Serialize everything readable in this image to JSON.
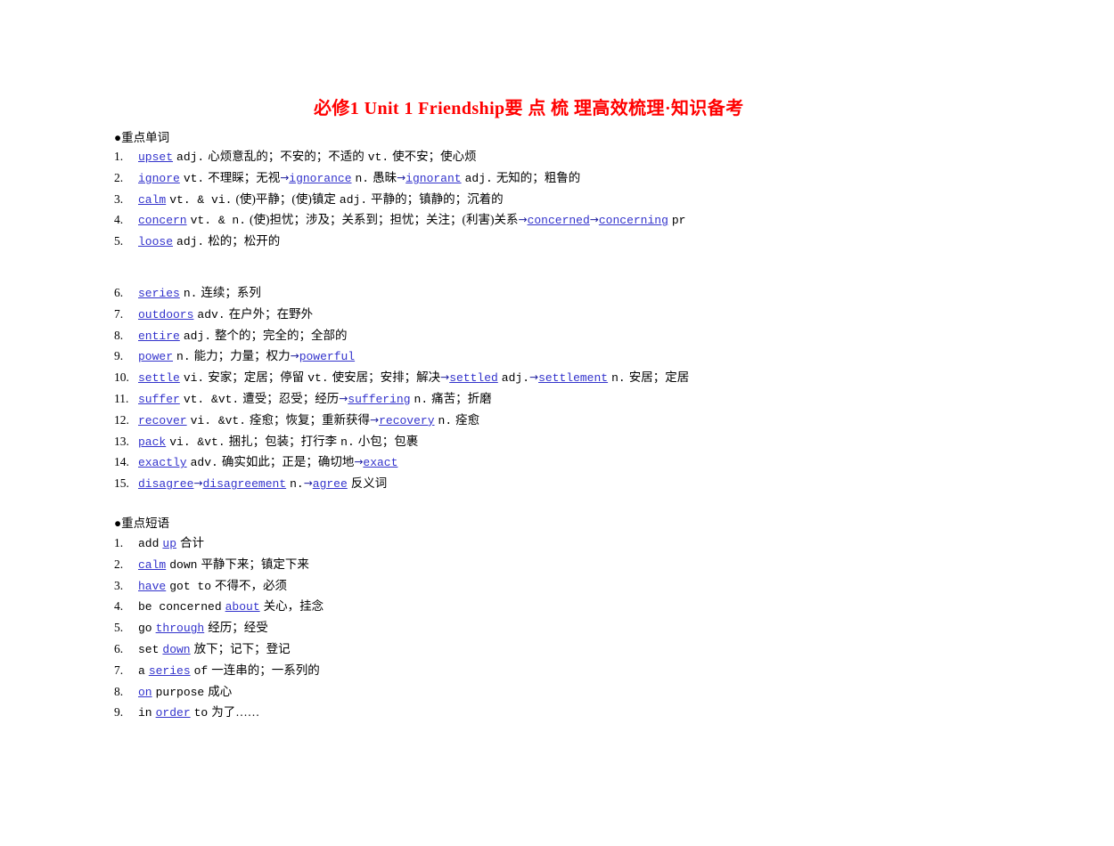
{
  "document": {
    "title": "必修1  Unit 1  Friendship要 点 梳 理高效梳理·知识备考",
    "title_color": "#ff0000",
    "keyword_color": "#3333cc",
    "background": "#ffffff"
  },
  "sections": [
    {
      "heading": "●重点单词",
      "heading_bullet": "●",
      "heading_text": "重点单词",
      "entries": [
        {
          "num": "1.",
          "parts": [
            {
              "t": "kw",
              "v": "upset"
            },
            {
              "t": "w",
              "v": "adj."
            },
            {
              "t": "cn",
              "v": "心烦意乱的；不安的；不适的"
            },
            {
              "t": "w",
              "v": "vt."
            },
            {
              "t": "cn",
              "v": "使不安；使心烦"
            }
          ]
        },
        {
          "num": "2.",
          "parts": [
            {
              "t": "kw",
              "v": "ignore"
            },
            {
              "t": "w",
              "v": "vt."
            },
            {
              "t": "cn",
              "v": "不理睬；无视"
            },
            {
              "t": "arrow",
              "v": "→"
            },
            {
              "t": "kw",
              "v": "ignorance"
            },
            {
              "t": "w",
              "v": "n."
            },
            {
              "t": "cn",
              "v": "愚昧"
            },
            {
              "t": "arrow",
              "v": "→"
            },
            {
              "t": "kw",
              "v": "ignorant"
            },
            {
              "t": "w",
              "v": "adj."
            },
            {
              "t": "cn",
              "v": "无知的；粗鲁的"
            }
          ]
        },
        {
          "num": "3.",
          "parts": [
            {
              "t": "kw",
              "v": "calm"
            },
            {
              "t": "w",
              "v": "vt. & vi."
            },
            {
              "t": "cn",
              "v": "(使)平静；(使)镇定"
            },
            {
              "t": "w",
              "v": "adj."
            },
            {
              "t": "cn",
              "v": "平静的；镇静的；沉着的"
            }
          ]
        },
        {
          "num": "4.",
          "parts": [
            {
              "t": "kw",
              "v": "concern"
            },
            {
              "t": "w",
              "v": "vt. & n."
            },
            {
              "t": "cn",
              "v": "(使)担忧；涉及；关系到；担忧；关注；(利害)关系"
            },
            {
              "t": "arrow",
              "v": "→"
            },
            {
              "t": "kw",
              "v": "concerned"
            },
            {
              "t": "arrow",
              "v": "→"
            },
            {
              "t": "kw",
              "v": "concerning"
            },
            {
              "t": "w",
              "v": "pr"
            }
          ]
        },
        {
          "num": "5.",
          "parts": [
            {
              "t": "kw",
              "v": "loose"
            },
            {
              "t": "w",
              "v": "adj."
            },
            {
              "t": "cn",
              "v": "松的；松开的"
            }
          ]
        }
      ],
      "entries_group2": [
        {
          "num": "6.",
          "parts": [
            {
              "t": "kw",
              "v": "series"
            },
            {
              "t": "w",
              "v": "n."
            },
            {
              "t": "cn",
              "v": "连续；系列"
            }
          ]
        },
        {
          "num": "7.",
          "parts": [
            {
              "t": "kw",
              "v": "outdoors"
            },
            {
              "t": "w",
              "v": "adv."
            },
            {
              "t": "cn",
              "v": "在户外；在野外"
            }
          ]
        },
        {
          "num": "8.",
          "parts": [
            {
              "t": "kw",
              "v": "entire"
            },
            {
              "t": "w",
              "v": "adj."
            },
            {
              "t": "cn",
              "v": "整个的；完全的；全部的"
            }
          ]
        },
        {
          "num": "9.",
          "parts": [
            {
              "t": "kw",
              "v": "power"
            },
            {
              "t": "w",
              "v": "n."
            },
            {
              "t": "cn",
              "v": "能力；力量；权力"
            },
            {
              "t": "arrow",
              "v": "→"
            },
            {
              "t": "kw",
              "v": "powerful"
            }
          ]
        },
        {
          "num": "10.",
          "parts": [
            {
              "t": "kw",
              "v": "settle"
            },
            {
              "t": "w",
              "v": "vi."
            },
            {
              "t": "cn",
              "v": "安家；定居；停留"
            },
            {
              "t": "w",
              "v": "vt."
            },
            {
              "t": "cn",
              "v": "使安居；安排；解决"
            },
            {
              "t": "arrow",
              "v": "→"
            },
            {
              "t": "kw",
              "v": "settled"
            },
            {
              "t": "w",
              "v": "adj."
            },
            {
              "t": "arrow",
              "v": "→"
            },
            {
              "t": "kw",
              "v": "settlement"
            },
            {
              "t": "w",
              "v": "n."
            },
            {
              "t": "cn",
              "v": "安居；定居"
            }
          ]
        },
        {
          "num": "11.",
          "parts": [
            {
              "t": "kw",
              "v": "suffer"
            },
            {
              "t": "w",
              "v": "vt. &vt."
            },
            {
              "t": "cn",
              "v": "遭受；忍受；经历"
            },
            {
              "t": "arrow",
              "v": "→"
            },
            {
              "t": "kw",
              "v": "suffering"
            },
            {
              "t": "w",
              "v": "n."
            },
            {
              "t": "cn",
              "v": "痛苦；折磨"
            }
          ]
        },
        {
          "num": "12.",
          "parts": [
            {
              "t": "kw",
              "v": "recover"
            },
            {
              "t": "w",
              "v": "vi. &vt."
            },
            {
              "t": "cn",
              "v": "痊愈；恢复；重新获得"
            },
            {
              "t": "arrow",
              "v": "→"
            },
            {
              "t": "kw",
              "v": "recovery"
            },
            {
              "t": "w",
              "v": "n."
            },
            {
              "t": "cn",
              "v": "痊愈"
            }
          ]
        },
        {
          "num": "13.",
          "parts": [
            {
              "t": "kw",
              "v": "pack"
            },
            {
              "t": "w",
              "v": "vi. &vt."
            },
            {
              "t": "cn",
              "v": "捆扎；包装；打行李"
            },
            {
              "t": "w",
              "v": "n."
            },
            {
              "t": "cn",
              "v": "小包；包裹"
            }
          ]
        },
        {
          "num": "14.",
          "parts": [
            {
              "t": "kw",
              "v": "exactly"
            },
            {
              "t": "w",
              "v": "adv."
            },
            {
              "t": "cn",
              "v": "确实如此；正是；确切地"
            },
            {
              "t": "arrow",
              "v": "→"
            },
            {
              "t": "kw",
              "v": "exact"
            }
          ]
        },
        {
          "num": "15.",
          "parts": [
            {
              "t": "kw",
              "v": "disagree"
            },
            {
              "t": "arrow",
              "v": "→"
            },
            {
              "t": "kw",
              "v": "disagreement"
            },
            {
              "t": "w",
              "v": "n."
            },
            {
              "t": "arrow",
              "v": "→"
            },
            {
              "t": "kw",
              "v": "agree"
            },
            {
              "t": "cn",
              "v": "反义词"
            }
          ]
        }
      ]
    },
    {
      "heading": "●重点短语",
      "heading_bullet": "●",
      "heading_text": "重点短语",
      "entries": [
        {
          "num": "1.",
          "parts": [
            {
              "t": "w",
              "v": "add"
            },
            {
              "t": "kw",
              "v": "up"
            },
            {
              "t": "cn",
              "v": "合计"
            }
          ]
        },
        {
          "num": "2.",
          "parts": [
            {
              "t": "kw",
              "v": "calm"
            },
            {
              "t": "w",
              "v": "down"
            },
            {
              "t": "cn",
              "v": "平静下来；镇定下来"
            }
          ]
        },
        {
          "num": "3.",
          "parts": [
            {
              "t": "kw",
              "v": "have"
            },
            {
              "t": "w",
              "v": "got to"
            },
            {
              "t": "cn",
              "v": "不得不，必须"
            }
          ]
        },
        {
          "num": "4.",
          "parts": [
            {
              "t": "w",
              "v": "be concerned"
            },
            {
              "t": "kw",
              "v": "about"
            },
            {
              "t": "cn",
              "v": "关心，挂念"
            }
          ]
        },
        {
          "num": "5.",
          "parts": [
            {
              "t": "w",
              "v": "go"
            },
            {
              "t": "kw",
              "v": "through"
            },
            {
              "t": "cn",
              "v": "经历；经受"
            }
          ]
        },
        {
          "num": "6.",
          "parts": [
            {
              "t": "w",
              "v": "set"
            },
            {
              "t": "kw",
              "v": "down"
            },
            {
              "t": "cn",
              "v": "放下；记下；登记"
            }
          ]
        },
        {
          "num": "7.",
          "parts": [
            {
              "t": "w",
              "v": "a"
            },
            {
              "t": "kw",
              "v": "series"
            },
            {
              "t": "w",
              "v": "of"
            },
            {
              "t": "cn",
              "v": "一连串的；一系列的"
            }
          ]
        },
        {
          "num": "8.",
          "parts": [
            {
              "t": "kw",
              "v": "on"
            },
            {
              "t": "w",
              "v": "purpose"
            },
            {
              "t": "cn",
              "v": "成心"
            }
          ]
        },
        {
          "num": "9.",
          "parts": [
            {
              "t": "w",
              "v": "in"
            },
            {
              "t": "kw",
              "v": "order"
            },
            {
              "t": "w",
              "v": "to"
            },
            {
              "t": "cn",
              "v": "为了……"
            }
          ]
        }
      ]
    }
  ]
}
